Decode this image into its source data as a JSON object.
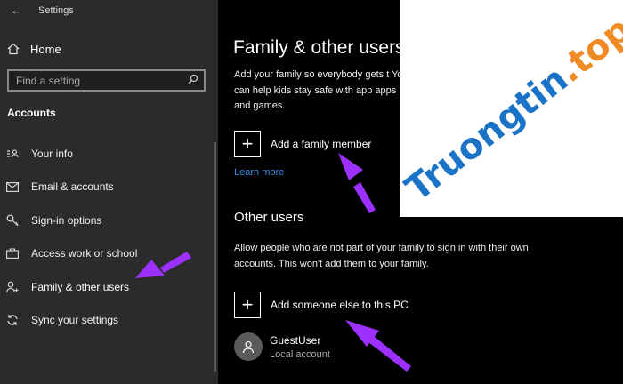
{
  "window": {
    "title": "Settings"
  },
  "sidebar": {
    "home_label": "Home",
    "search_placeholder": "Find a setting",
    "section_title": "Accounts",
    "items": [
      {
        "label": "Your info",
        "icon": "contact-card-icon"
      },
      {
        "label": "Email & accounts",
        "icon": "mail-icon"
      },
      {
        "label": "Sign-in options",
        "icon": "key-icon"
      },
      {
        "label": "Access work or school",
        "icon": "briefcase-icon"
      },
      {
        "label": "Family & other users",
        "icon": "person-add-icon"
      },
      {
        "label": "Sync your settings",
        "icon": "sync-icon"
      }
    ]
  },
  "main": {
    "title": "Family & other users",
    "family_desc": "Add your family so everybody gets t You can help kids stay safe with app apps and games.",
    "add_family_label": "Add a family member",
    "learn_more": "Learn more",
    "other_users_title": "Other users",
    "other_users_desc": "Allow people who are not part of your family to sign in with their own accounts. This won't add them to your family.",
    "add_other_label": "Add someone else to this PC",
    "user": {
      "name": "GuestUser",
      "type": "Local account"
    }
  },
  "watermark": {
    "main": "Truongtin",
    "tld": ".top"
  },
  "colors": {
    "sidebar_bg": "#2b2b2b",
    "link": "#3a8ee6",
    "arrow": "#9b30ff"
  }
}
